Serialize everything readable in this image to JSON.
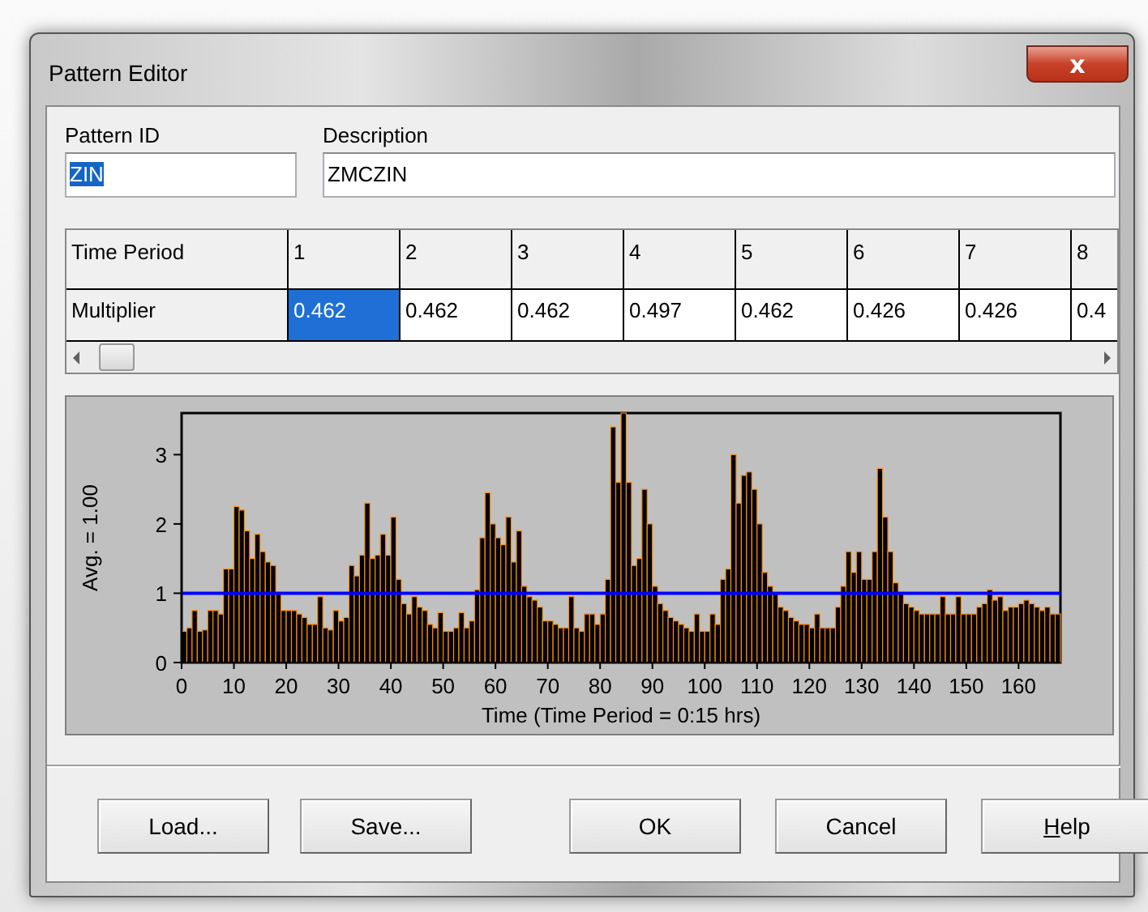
{
  "window": {
    "title": "Pattern Editor",
    "close_label": "x"
  },
  "fields": [
    {
      "label": "Pattern ID",
      "value": "ZIN",
      "text_selected": true
    },
    {
      "label": "Description",
      "value": "ZMCZIN",
      "text_selected": false
    }
  ],
  "grid": {
    "header_label": "Time Period",
    "row_label": "Multiplier",
    "periods": [
      "1",
      "2",
      "3",
      "4",
      "5",
      "6",
      "7",
      "8"
    ],
    "multipliers": [
      {
        "value": "0.462",
        "selected": true
      },
      {
        "value": "0.462",
        "selected": false
      },
      {
        "value": "0.462",
        "selected": false
      },
      {
        "value": "0.497",
        "selected": false
      },
      {
        "value": "0.462",
        "selected": false
      },
      {
        "value": "0.426",
        "selected": false
      },
      {
        "value": "0.426",
        "selected": false
      },
      {
        "value": "0.4",
        "selected": false
      }
    ]
  },
  "chart": {
    "chart_data": {
      "type": "bar",
      "xlabel": "Time (Time Period = 0:15 hrs)",
      "ylabel": "Avg. = 1.00",
      "x": [
        0,
        1,
        2,
        3,
        4,
        5,
        6,
        7,
        8,
        9,
        10,
        11,
        12,
        13,
        14,
        15,
        16,
        17,
        18,
        19,
        20,
        21,
        22,
        23,
        24,
        25,
        26,
        27,
        28,
        29,
        30,
        31,
        32,
        33,
        34,
        35,
        36,
        37,
        38,
        39,
        40,
        41,
        42,
        43,
        44,
        45,
        46,
        47,
        48,
        49,
        50,
        51,
        52,
        53,
        54,
        55,
        56,
        57,
        58,
        59,
        60,
        61,
        62,
        63,
        64,
        65,
        66,
        67,
        68,
        69,
        70,
        71,
        72,
        73,
        74,
        75,
        76,
        77,
        78,
        79,
        80,
        81,
        82,
        83,
        84,
        85,
        86,
        87,
        88,
        89,
        90,
        91,
        92,
        93,
        94,
        95,
        96,
        97,
        98,
        99,
        100,
        101,
        102,
        103,
        104,
        105,
        106,
        107,
        108,
        109,
        110,
        111,
        112,
        113,
        114,
        115,
        116,
        117,
        118,
        119,
        120,
        121,
        122,
        123,
        124,
        125,
        126,
        127,
        128,
        129,
        130,
        131,
        132,
        133,
        134,
        135,
        136,
        137,
        138,
        139,
        140,
        141,
        142,
        143,
        144,
        145,
        146,
        147,
        148,
        149,
        150,
        151,
        152,
        153,
        154,
        155,
        156,
        157,
        158,
        159,
        160,
        161,
        162,
        163,
        164,
        165,
        166,
        167
      ],
      "values": [
        0.45,
        0.5,
        0.75,
        0.45,
        0.47,
        0.75,
        0.75,
        0.7,
        1.35,
        1.35,
        2.25,
        2.2,
        1.9,
        1.5,
        1.85,
        1.6,
        1.45,
        1.4,
        1.0,
        0.75,
        0.75,
        0.75,
        0.7,
        0.65,
        0.55,
        0.55,
        0.95,
        0.5,
        0.47,
        0.75,
        0.6,
        0.65,
        1.4,
        1.25,
        1.55,
        2.3,
        1.5,
        1.55,
        1.85,
        1.55,
        2.1,
        1.2,
        0.85,
        0.7,
        0.95,
        0.8,
        0.75,
        0.55,
        0.5,
        0.72,
        0.45,
        0.45,
        0.5,
        0.72,
        0.5,
        0.6,
        1.05,
        1.8,
        2.45,
        2.0,
        1.8,
        1.7,
        2.1,
        1.45,
        1.9,
        1.1,
        0.95,
        0.9,
        0.8,
        0.6,
        0.6,
        0.55,
        0.5,
        0.5,
        0.95,
        0.5,
        0.45,
        0.7,
        0.7,
        0.55,
        0.7,
        1.2,
        3.4,
        2.6,
        3.6,
        2.6,
        1.4,
        1.5,
        2.5,
        2.0,
        1.1,
        0.85,
        0.75,
        0.65,
        0.6,
        0.55,
        0.5,
        0.45,
        0.7,
        0.45,
        0.45,
        0.7,
        0.55,
        1.2,
        1.35,
        3.0,
        2.3,
        2.7,
        2.75,
        2.5,
        2.0,
        1.3,
        1.1,
        1.0,
        0.8,
        0.75,
        0.65,
        0.6,
        0.55,
        0.55,
        0.5,
        0.7,
        0.5,
        0.5,
        0.5,
        0.8,
        1.1,
        1.6,
        1.3,
        1.6,
        1.2,
        1.2,
        1.6,
        2.8,
        2.1,
        1.6,
        1.15,
        1.0,
        0.85,
        0.8,
        0.75,
        0.7,
        0.7,
        0.7,
        0.7,
        0.95,
        0.7,
        0.7,
        0.95,
        0.7,
        0.7,
        0.7,
        0.8,
        0.85,
        1.05,
        0.9,
        0.95,
        0.75,
        0.8,
        0.8,
        0.85,
        0.9,
        0.85,
        0.8,
        0.75,
        0.8,
        0.7,
        0.7
      ],
      "xlim": [
        0,
        168
      ],
      "ylim": [
        0,
        3.6
      ],
      "xticks": [
        0,
        10,
        20,
        30,
        40,
        50,
        60,
        70,
        80,
        90,
        100,
        110,
        120,
        130,
        140,
        150,
        160
      ],
      "yticks": [
        0,
        1,
        2,
        3
      ],
      "ref_lines": [
        {
          "axis": "y",
          "value": 1,
          "color": "#0000ff"
        }
      ]
    }
  },
  "buttons": [
    {
      "label": "Load...",
      "underline_first": false
    },
    {
      "label": "Save...",
      "underline_first": false
    },
    {
      "label": "OK",
      "underline_first": false
    },
    {
      "label": "Cancel",
      "underline_first": false
    },
    {
      "label": "Help",
      "underline_first": true
    }
  ]
}
